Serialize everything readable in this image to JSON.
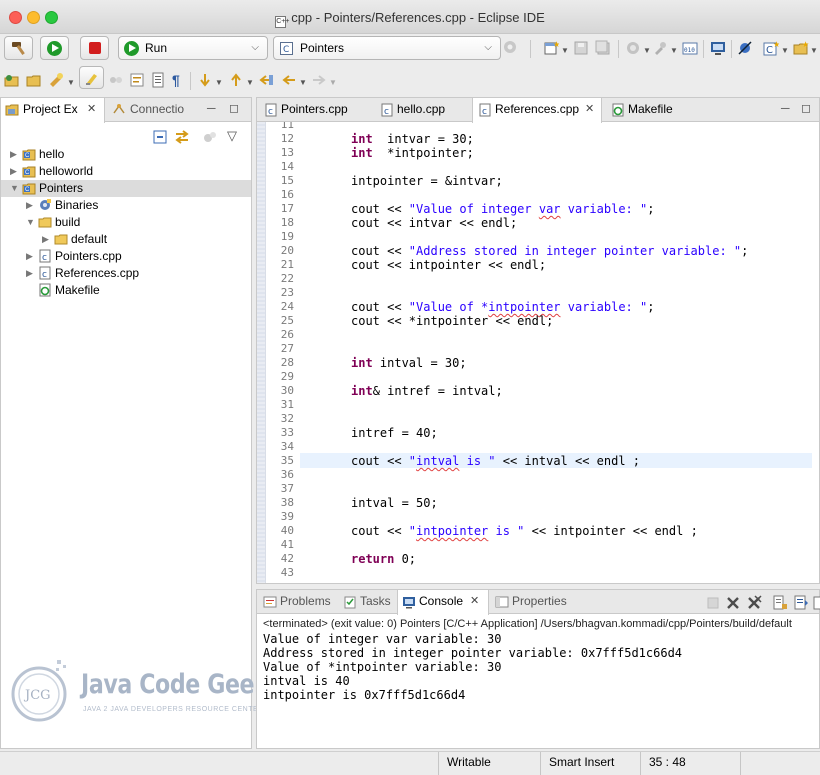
{
  "window": {
    "title": "cpp - Pointers/References.cpp - Eclipse IDE",
    "title_icon_text": "C++"
  },
  "toolbar": {
    "run_config": "Run",
    "launch_target": "Pointers"
  },
  "project_explorer": {
    "tabs": [
      {
        "label": "Project Ex",
        "active": true
      },
      {
        "label": "Connectio",
        "active": false
      }
    ],
    "tree": [
      {
        "label": "hello",
        "depth": 0,
        "expanded": false,
        "icon": "project-icon"
      },
      {
        "label": "helloworld",
        "depth": 0,
        "expanded": false,
        "icon": "project-icon"
      },
      {
        "label": "Pointers",
        "depth": 0,
        "expanded": true,
        "icon": "project-icon",
        "selected": true
      },
      {
        "label": "Binaries",
        "depth": 1,
        "expanded": false,
        "icon": "binaries-icon"
      },
      {
        "label": "build",
        "depth": 1,
        "expanded": true,
        "icon": "folder-icon"
      },
      {
        "label": "default",
        "depth": 2,
        "expanded": false,
        "icon": "folder-icon"
      },
      {
        "label": "Pointers.cpp",
        "depth": 1,
        "expanded": false,
        "icon": "cpp-file-icon"
      },
      {
        "label": "References.cpp",
        "depth": 1,
        "expanded": false,
        "icon": "cpp-file-icon"
      },
      {
        "label": "Makefile",
        "depth": 1,
        "expanded": null,
        "icon": "makefile-icon"
      }
    ]
  },
  "watermark": {
    "logo_text": "JCG",
    "brand": "Java Code Geeks",
    "tagline": "JAVA 2 JAVA DEVELOPERS RESOURCE CENTER"
  },
  "editor": {
    "tabs": [
      {
        "label": "Pointers.cpp",
        "active": false
      },
      {
        "label": "hello.cpp",
        "active": false
      },
      {
        "label": "References.cpp",
        "active": true
      },
      {
        "label": "Makefile",
        "active": false
      }
    ],
    "current_line": 35,
    "lines": [
      {
        "n": "11",
        "code": []
      },
      {
        "n": "12",
        "code": [
          {
            "t": "kw",
            "v": "int"
          },
          {
            "t": "p",
            "v": "  intvar = 30;"
          }
        ]
      },
      {
        "n": "13",
        "code": [
          {
            "t": "kw",
            "v": "int"
          },
          {
            "t": "p",
            "v": "  *intpointer;"
          }
        ]
      },
      {
        "n": "14",
        "code": []
      },
      {
        "n": "15",
        "code": [
          {
            "t": "p",
            "v": "intpointer = &intvar;"
          }
        ]
      },
      {
        "n": "16",
        "code": []
      },
      {
        "n": "17",
        "code": [
          {
            "t": "p",
            "v": "cout << "
          },
          {
            "t": "str",
            "v": "\"Value of integer "
          },
          {
            "t": "strsq",
            "v": "var"
          },
          {
            "t": "str",
            "v": " variable: \""
          },
          {
            "t": "p",
            "v": ";"
          }
        ]
      },
      {
        "n": "18",
        "code": [
          {
            "t": "p",
            "v": "cout << intvar << endl;"
          }
        ]
      },
      {
        "n": "19",
        "code": []
      },
      {
        "n": "20",
        "code": [
          {
            "t": "p",
            "v": "cout << "
          },
          {
            "t": "str",
            "v": "\"Address stored in integer pointer variable: \""
          },
          {
            "t": "p",
            "v": ";"
          }
        ]
      },
      {
        "n": "21",
        "code": [
          {
            "t": "p",
            "v": "cout << intpointer << endl;"
          }
        ]
      },
      {
        "n": "22",
        "code": []
      },
      {
        "n": "23",
        "code": []
      },
      {
        "n": "24",
        "code": [
          {
            "t": "p",
            "v": "cout << "
          },
          {
            "t": "str",
            "v": "\"Value of *"
          },
          {
            "t": "strsq",
            "v": "intpointer"
          },
          {
            "t": "str",
            "v": " variable: \""
          },
          {
            "t": "p",
            "v": ";"
          }
        ]
      },
      {
        "n": "25",
        "code": [
          {
            "t": "p",
            "v": "cout << *intpointer << endl;"
          }
        ]
      },
      {
        "n": "26",
        "code": []
      },
      {
        "n": "27",
        "code": []
      },
      {
        "n": "28",
        "code": [
          {
            "t": "kw",
            "v": "int"
          },
          {
            "t": "p",
            "v": " intval = 30;"
          }
        ]
      },
      {
        "n": "29",
        "code": []
      },
      {
        "n": "30",
        "code": [
          {
            "t": "kw",
            "v": "int"
          },
          {
            "t": "p",
            "v": "& intref = intval;"
          }
        ]
      },
      {
        "n": "31",
        "code": []
      },
      {
        "n": "32",
        "code": []
      },
      {
        "n": "33",
        "code": [
          {
            "t": "p",
            "v": "intref = 40;"
          }
        ]
      },
      {
        "n": "34",
        "code": []
      },
      {
        "n": "35",
        "code": [
          {
            "t": "p",
            "v": "cout << "
          },
          {
            "t": "str",
            "v": "\""
          },
          {
            "t": "strsq",
            "v": "intval"
          },
          {
            "t": "str",
            "v": " is \""
          },
          {
            "t": "p",
            "v": " << intval << endl ;"
          }
        ]
      },
      {
        "n": "36",
        "code": []
      },
      {
        "n": "37",
        "code": []
      },
      {
        "n": "38",
        "code": [
          {
            "t": "p",
            "v": "intval = 50;"
          }
        ]
      },
      {
        "n": "39",
        "code": []
      },
      {
        "n": "40",
        "code": [
          {
            "t": "p",
            "v": "cout << "
          },
          {
            "t": "str",
            "v": "\""
          },
          {
            "t": "strsq",
            "v": "intpointer"
          },
          {
            "t": "str",
            "v": " is \""
          },
          {
            "t": "p",
            "v": " << intpointer << endl ;"
          }
        ]
      },
      {
        "n": "41",
        "code": []
      },
      {
        "n": "42",
        "code": [
          {
            "t": "kw",
            "v": "return"
          },
          {
            "t": "p",
            "v": " 0;"
          }
        ]
      },
      {
        "n": "43",
        "code": []
      }
    ]
  },
  "console": {
    "tabs": [
      {
        "label": "Problems",
        "active": false
      },
      {
        "label": "Tasks",
        "active": false
      },
      {
        "label": "Console",
        "active": true
      },
      {
        "label": "Properties",
        "active": false
      }
    ],
    "header": "<terminated> (exit value: 0) Pointers [C/C++ Application] /Users/bhagvan.kommadi/cpp/Pointers/build/default",
    "output": [
      "Value of integer var variable: 30",
      "Address stored in integer pointer variable: 0x7fff5d1c66d4",
      "Value of *intpointer variable: 30",
      "intval is 40",
      "intpointer is 0x7fff5d1c66d4"
    ]
  },
  "statusbar": {
    "mode": "Writable",
    "insert_mode": "Smart Insert",
    "position": "35 : 48"
  }
}
